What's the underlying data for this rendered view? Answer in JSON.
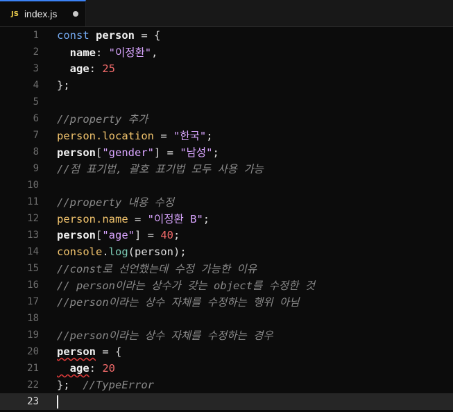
{
  "tab": {
    "lang_badge": "JS",
    "filename": "index.js"
  },
  "lines": {
    "l1": {
      "num": "1",
      "a": "const",
      "b": " person",
      "c": " = {"
    },
    "l2": {
      "num": "2",
      "a": "  name",
      "b": ": ",
      "c": "\"이정환\"",
      "d": ","
    },
    "l3": {
      "num": "3",
      "a": "  age",
      "b": ": ",
      "c": "25"
    },
    "l4": {
      "num": "4",
      "a": "};"
    },
    "l5": {
      "num": "5"
    },
    "l6": {
      "num": "6",
      "a": "//property 추가"
    },
    "l7": {
      "num": "7",
      "a": "person",
      "b": ".location",
      "c": " = ",
      "d": "\"한국\"",
      "e": ";"
    },
    "l8": {
      "num": "8",
      "a": "person",
      "b": "[",
      "c": "\"gender\"",
      "d": "] = ",
      "e": "\"남성\"",
      "f": ";"
    },
    "l9": {
      "num": "9",
      "a": "//점 표기법, 괄호 표기법 모두 사용 가능"
    },
    "l10": {
      "num": "10"
    },
    "l11": {
      "num": "11",
      "a": "//property 내용 수정"
    },
    "l12": {
      "num": "12",
      "a": "person",
      "b": ".name",
      "c": " = ",
      "d": "\"이정환 B\"",
      "e": ";"
    },
    "l13": {
      "num": "13",
      "a": "person",
      "b": "[",
      "c": "\"age\"",
      "d": "] = ",
      "e": "40",
      "f": ";"
    },
    "l14": {
      "num": "14",
      "a": "console",
      "b": ".",
      "c": "log",
      "d": "(person);"
    },
    "l15": {
      "num": "15",
      "a": "//const로 선언했는데 수정 가능한 이유"
    },
    "l16": {
      "num": "16",
      "a": "// person이라는 상수가 갖는 object를 수정한 것"
    },
    "l17": {
      "num": "17",
      "a": "//person이라는 상수 자체를 수정하는 행위 아님"
    },
    "l18": {
      "num": "18"
    },
    "l19": {
      "num": "19",
      "a": "//person이라는 상수 자체를 수정하는 경우"
    },
    "l20": {
      "num": "20",
      "a": "person",
      "b": " = {"
    },
    "l21": {
      "num": "21",
      "a": "  age",
      "b": ": ",
      "c": "20"
    },
    "l22": {
      "num": "22",
      "a": "};",
      "b": "  //TypeError"
    },
    "l23": {
      "num": "23"
    }
  },
  "colors": {
    "keyword": "#74a9f0",
    "property": "#f2c46d",
    "string": "#d9a5ff",
    "number": "#f46b6b",
    "function": "#7dcdb7",
    "comment": "#8a8a8a",
    "tab_accent": "#3b82f6",
    "error_squiggle": "#e03b3b"
  },
  "icons": {
    "tab_badge": "js-file-icon",
    "unsaved": "unsaved-dot-icon"
  }
}
